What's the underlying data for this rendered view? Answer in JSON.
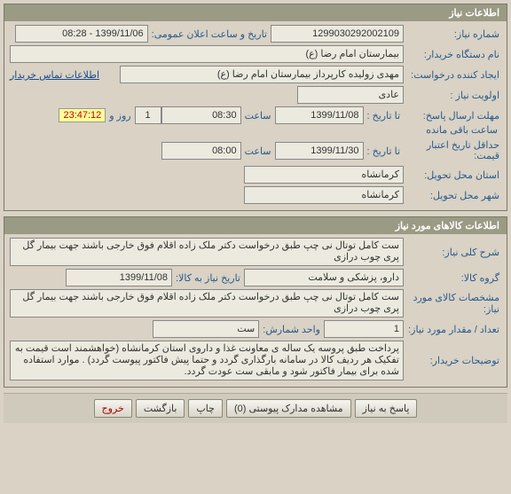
{
  "section1": {
    "title": "اطلاعات نیاز",
    "need_no_label": "شماره نیاز:",
    "need_no": "1299030292002109",
    "pub_label": "تاریخ و ساعت اعلان عمومی:",
    "pub_value": "1399/11/06 - 08:28",
    "org_label": "نام دستگاه خریدار:",
    "org_value": "بیمارستان امام رضا (ع)",
    "creator_label": "ایجاد کننده درخواست:",
    "creator_value": "مهدی زولیده کارپرداز بیمارستان امام رضا (ع)",
    "contact_link": "اطلاعات تماس خریدار",
    "priority_label": "اولویت نیاز :",
    "priority_value": "عادی",
    "deadline_label": "مهلت ارسال پاسخ:",
    "deadline_to_label": "تا تاریخ :",
    "deadline_date": "1399/11/08",
    "time_label": "ساعت",
    "deadline_time": "08:30",
    "days_value": "1",
    "days_label": "روز و",
    "countdown": "23:47:12",
    "countdown_label": "ساعت باقی مانده",
    "min_credit_label": "حداقل تاریخ اعتبار قیمت:",
    "min_credit_to": "تا تاریخ :",
    "min_credit_date": "1399/11/30",
    "min_credit_time": "08:00",
    "province_label": "استان محل تحویل:",
    "province_value": "کرمانشاه",
    "city_label": "شهر محل تحویل:",
    "city_value": "کرمانشاه"
  },
  "section2": {
    "title": "اطلاعات کالاهای مورد نیاز",
    "desc_label": "شرح کلی نیاز:",
    "desc_value": "ست کامل توتال نی چپ طبق درخواست دکتر ملک زاده اقلام فوق خارجی باشند جهت بیمار گل پری چوب درازی",
    "group_label": "گروه کالا:",
    "group_value": "دارو، پزشکی و سلامت",
    "date_to_label": "تاریخ نیاز به کالا:",
    "date_to_value": "1399/11/08",
    "spec_label": "مشخصات کالای مورد نیاز:",
    "spec_value": "ست کامل توتال نی چپ طبق درخواست دکتر ملک زاده اقلام فوق خارجی باشند جهت بیمار گل پری چوب درازی",
    "qty_label": "تعداد / مقدار مورد نیاز:",
    "qty_value": "1",
    "unit_label": "واحد شمارش:",
    "unit_value": "ست",
    "notes_label": "توضیحات خریدار:",
    "notes_value": "پرداخت طبق پروسه یک ساله ی معاونت غذا و داروی استان کرمانشاه (خواهشمند است قیمت به تفکیک هر ردیف کالا در سامانه بارگذاری گردد و حتما پیش فاکتور پیوست گردد) . موارد استفاده شده برای بیمار فاکتور شود و مابقی ست عودت گردد."
  },
  "buttons": {
    "reply": "پاسخ به نیاز",
    "attach": "مشاهده مدارک پیوستی (0)",
    "print": "چاپ",
    "back": "بازگشت",
    "exit": "خروج"
  }
}
